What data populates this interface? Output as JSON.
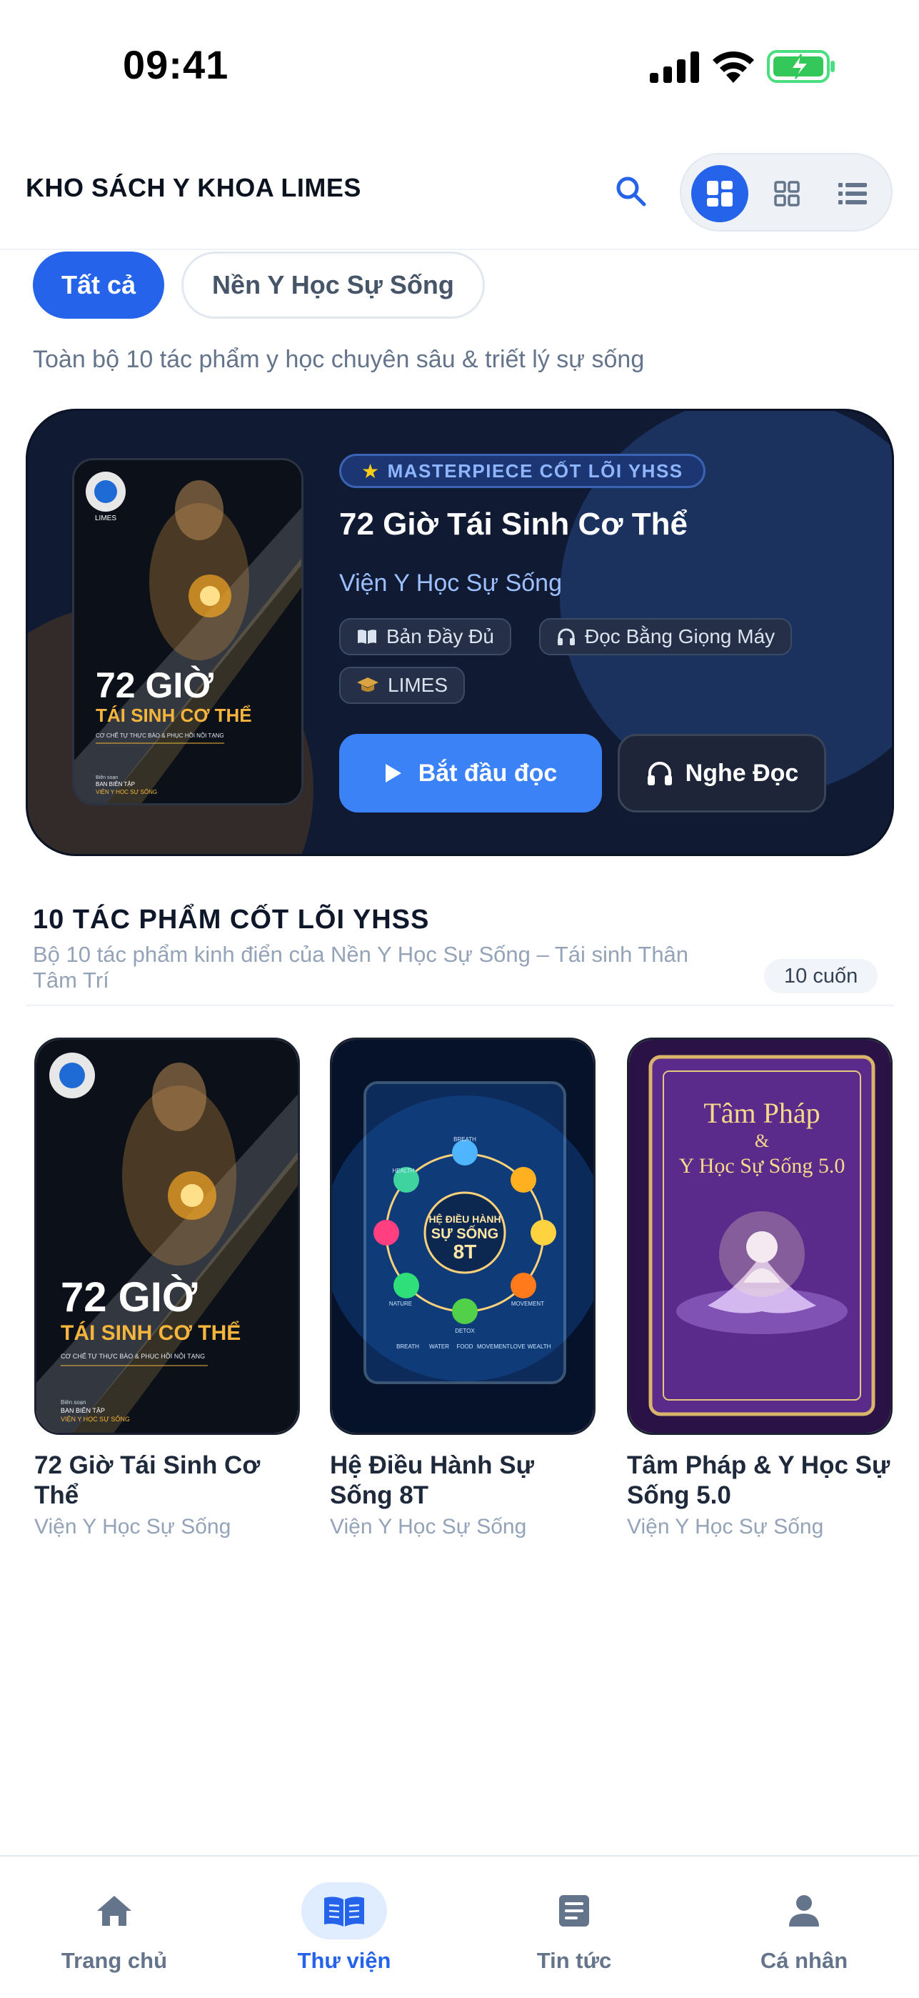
{
  "status_bar": {
    "time": "09:41"
  },
  "header": {
    "title": "KHO SÁCH Y KHOA LIMES"
  },
  "filters": {
    "chips": [
      "Tất cả",
      "Nền Y Học Sự Sống"
    ],
    "active": "Tất cả"
  },
  "subtitle": "Toàn bộ 10 tác phẩm y học chuyên sâu & triết lý sự sống",
  "featured": {
    "badge": "MASTERPIECE CỐT LÕI YHSS",
    "title": "72 Giờ Tái Sinh Cơ Thể",
    "author": "Viện Y Học Sự Sống",
    "tags": [
      "Bản Đầy Đủ",
      "Đọc Bằng Giọng Máy",
      "LIMES"
    ],
    "read_button": "Bắt đầu đọc",
    "listen_button": "Nghe Đọc",
    "cover": {
      "title_line1": "72 GIỜ",
      "title_line2": "TÁI SINH CƠ THỂ",
      "tagline": "CƠ CHẾ TỰ THỰC BÀO & PHỤC HỒI NỘI TẠNG",
      "editor_label": "Biên soạn",
      "editor_line1": "BAN BIÊN TẬP",
      "editor_line2": "VIỆN Y HỌC SỰ SỐNG",
      "logo_text": "LIMES"
    }
  },
  "section": {
    "title": "10 TÁC PHẨM CỐT LÕI YHSS",
    "description": "Bộ 10 tác phẩm kinh điển của Nền Y Học Sự Sống – Tái sinh Thân Tâm Trí",
    "count": "10 cuốn"
  },
  "books": [
    {
      "title": "72 Giờ Tái Sinh Cơ Thể",
      "author": "Viện Y Học Sự Sống",
      "cover_line1": "72 GIỜ",
      "cover_line2": "TÁI SINH CƠ THỂ",
      "cover_tagline": "CƠ CHẾ TỰ THỰC BÀO & PHỤC HỒI NỘI TẠNG",
      "cover_editor_label": "Biên soạn",
      "cover_editor_line1": "BAN BIÊN TẬP",
      "cover_editor_line2": "VIỆN Y HỌC SỰ SỐNG"
    },
    {
      "title": "Hệ Điều Hành Sự Sống 8T",
      "author": "Viện Y Học Sự Sống",
      "cover_line1": "HỆ ĐIỀU HÀNH",
      "cover_line2": "SỰ SỐNG",
      "cover_line3": "8T",
      "cover_words": [
        "BREATH",
        "WATER",
        "FOOD",
        "MOVEMENT",
        "LOVE",
        "WEALTH",
        "NATURE",
        "DETOX",
        "HEALTH"
      ]
    },
    {
      "title": "Tâm Pháp & Y Học Sự Sống 5.0",
      "author": "Viện Y Học Sự Sống",
      "cover_line1": "Tâm Pháp",
      "cover_line2": "&",
      "cover_line3": "Y Học Sự Sống 5.0"
    }
  ],
  "tabbar": {
    "items": [
      {
        "label": "Trang chủ",
        "icon": "home-icon"
      },
      {
        "label": "Thư viện",
        "icon": "book-open-icon"
      },
      {
        "label": "Tin tức",
        "icon": "article-icon"
      },
      {
        "label": "Cá nhân",
        "icon": "person-icon"
      }
    ],
    "active": "Thư viện"
  },
  "colors": {
    "accent": "#2563eb",
    "hero_bg": "#101a33",
    "badge_text": "#8fb5ff",
    "muted": "#94a3b8"
  }
}
